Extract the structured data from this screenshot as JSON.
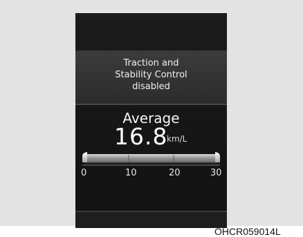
{
  "message": {
    "lines": [
      "Traction and",
      "Stability Control",
      "disabled"
    ]
  },
  "fuel_economy": {
    "label": "Average",
    "value": "16.8",
    "unit": "km/L",
    "gauge_ticks": [
      "0",
      "10",
      "20",
      "30"
    ],
    "gauge_level": 1.0
  },
  "figure_code": "OHCR059014L",
  "colors": {
    "display_background": "#161616",
    "message_panel": "#333333",
    "text": "#f1f1f1"
  }
}
